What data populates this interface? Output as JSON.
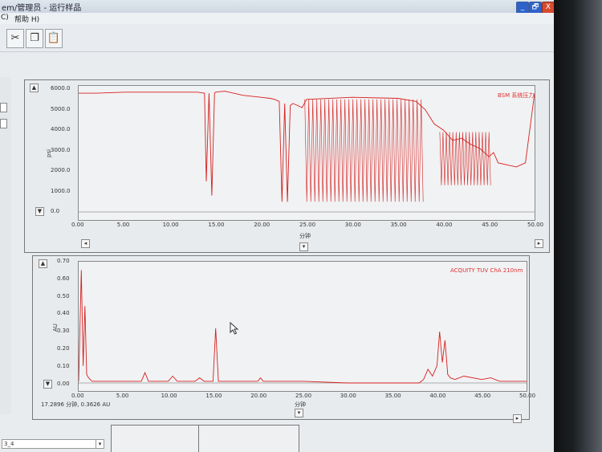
{
  "window": {
    "title": "em/管理员 - 运行样品",
    "controls": {
      "minimize": "_",
      "restore": "🗗",
      "close": "X"
    }
  },
  "menu": [
    {
      "label": "C)"
    },
    {
      "label": "帮助 H)"
    }
  ],
  "toolbar": {
    "buttons": [
      {
        "icon": "cut-icon",
        "glyph": "✂"
      },
      {
        "icon": "copy-icon",
        "glyph": "❐"
      },
      {
        "icon": "paste-icon",
        "glyph": "📋"
      }
    ]
  },
  "pressure_chart": {
    "legend": "BSM 系统压力",
    "ylabel": "psi",
    "xlabel": "分钟",
    "ytick_labels": [
      "6000.0",
      "5000.0",
      "4000.0",
      "3000.0",
      "2000.0",
      "1000.0",
      "0.0"
    ],
    "xtick_labels": [
      "0.00",
      "5.00",
      "10.00",
      "15.00",
      "20.00",
      "25.00",
      "30.00",
      "35.00",
      "40.00",
      "45.00",
      "50.00"
    ]
  },
  "uv_chart": {
    "legend": "ACQUITY TUV ChA 210nm",
    "ylabel": "AU",
    "xlabel": "分钟",
    "readout": "17.2896 分钟, 0.3626 AU",
    "ytick_labels": [
      "0.70",
      "0.60",
      "0.50",
      "0.40",
      "0.30",
      "0.20",
      "0.10",
      "0.00"
    ],
    "xtick_labels": [
      "0.00",
      "5.00",
      "10.00",
      "15.00",
      "20.00",
      "25.00",
      "30.00",
      "35.00",
      "40.00",
      "45.00",
      "50.00"
    ]
  },
  "bottom": {
    "combo_value": "3_4",
    "combo_arrow": "▾"
  },
  "chart_data": [
    {
      "type": "line",
      "title": "BSM 系统压力",
      "xlabel": "分钟",
      "ylabel": "psi",
      "xlim": [
        0,
        50
      ],
      "ylim": [
        0,
        6000
      ],
      "color": "#d62020",
      "series": [
        {
          "name": "BSM 系统压力",
          "x": [
            0,
            2,
            5,
            8,
            10,
            13,
            13.8,
            14.0,
            14.3,
            14.6,
            14.9,
            15,
            16,
            17,
            18,
            19,
            20,
            21,
            21.5,
            22,
            22.3,
            22.6,
            22.9,
            23.2,
            23.5,
            24,
            24.5,
            25,
            30,
            35,
            37,
            38,
            39,
            40,
            41,
            42,
            43,
            44,
            45,
            45.5,
            46,
            47,
            48,
            49,
            50
          ],
          "y": [
            5800,
            5800,
            5850,
            5850,
            5850,
            5850,
            5800,
            1500,
            5800,
            800,
            5800,
            5850,
            5900,
            5800,
            5700,
            5650,
            5600,
            5550,
            5500,
            5400,
            500,
            5300,
            500,
            5200,
            5300,
            5200,
            5100,
            5500,
            5600,
            5550,
            5400,
            5000,
            4300,
            4000,
            3500,
            3600,
            3300,
            3100,
            2700,
            2900,
            2400,
            2300,
            2200,
            2400,
            5800
          ]
        }
      ]
    },
    {
      "type": "line",
      "title": "ACQUITY TUV ChA 210nm",
      "xlabel": "分钟",
      "ylabel": "AU",
      "xlim": [
        0,
        50
      ],
      "ylim": [
        0,
        0.7
      ],
      "color": "#d62020",
      "series": [
        {
          "name": "ACQUITY TUV ChA 210nm",
          "x": [
            0,
            0.3,
            0.5,
            0.7,
            0.9,
            1.1,
            1.5,
            2,
            5,
            7,
            7.4,
            7.8,
            10,
            10.5,
            11,
            13,
            13.5,
            14,
            15,
            15.3,
            15.6,
            16,
            20,
            20.3,
            20.6,
            25,
            30,
            35,
            38,
            38.5,
            39,
            39.5,
            40,
            40.3,
            40.6,
            40.9,
            41.2,
            41.5,
            42,
            43,
            45,
            46,
            47,
            48,
            49,
            50
          ],
          "y": [
            0.01,
            0.66,
            0.1,
            0.45,
            0.05,
            0.03,
            0.01,
            0.01,
            0.01,
            0.01,
            0.06,
            0.01,
            0.01,
            0.04,
            0.01,
            0.01,
            0.03,
            0.01,
            0.01,
            0.32,
            0.01,
            0.01,
            0.01,
            0.03,
            0.01,
            0.01,
            0.0,
            0.0,
            0.0,
            0.02,
            0.08,
            0.04,
            0.1,
            0.3,
            0.12,
            0.25,
            0.05,
            0.03,
            0.02,
            0.04,
            0.02,
            0.03,
            0.01,
            0.01,
            0.01,
            0.01
          ]
        }
      ]
    }
  ]
}
